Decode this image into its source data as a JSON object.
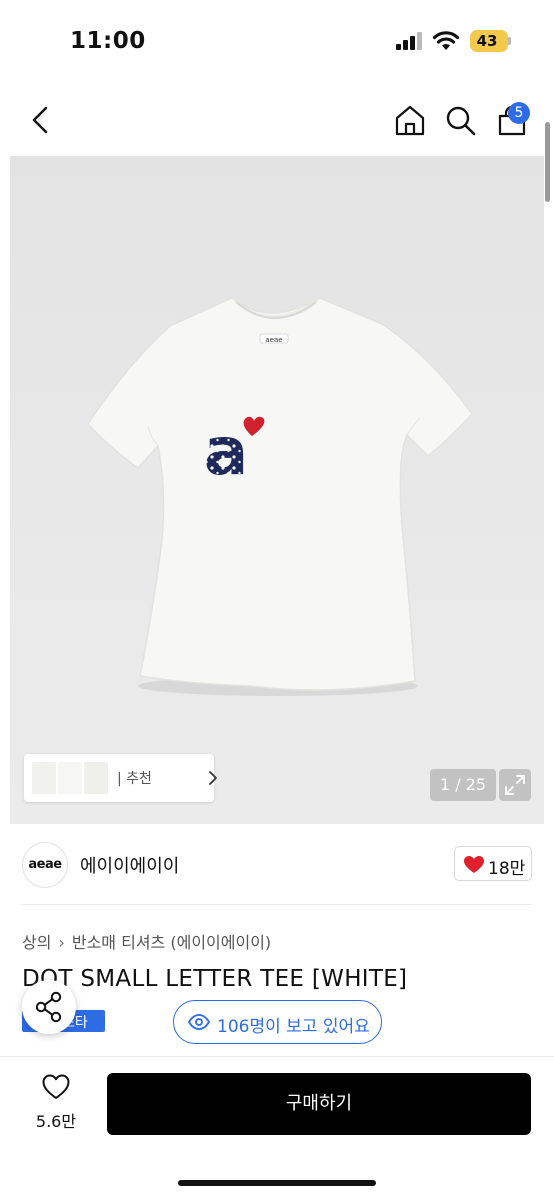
{
  "status_bar": {
    "time": "11:00",
    "battery_level": "43"
  },
  "nav": {
    "cart_count": "5",
    "icons": [
      "back-icon",
      "home-icon",
      "search-icon",
      "cart-icon"
    ]
  },
  "gallery": {
    "recommend_label": "| 추천",
    "counter": "1 / 25",
    "print_letter": "a"
  },
  "brand": {
    "logo_text": "aeae",
    "name": "에이이에이이",
    "likes": "18만"
  },
  "breadcrumb": {
    "category": "상의",
    "subcategory": "반소매 티셔츠 (에이이에이이)"
  },
  "product": {
    "title": "DOT SMALL LETTER TEE [WHITE]",
    "tag_label": "스타",
    "viewers_label": "106명이 보고 있어요"
  },
  "bottom_bar": {
    "wish_count": "5.6만",
    "buy_label": "구매하기"
  },
  "colors": {
    "accent": "#2e6ce6",
    "heart": "#e0202f",
    "navy_print": "#1f2a5c",
    "buy_button": "#000000"
  }
}
